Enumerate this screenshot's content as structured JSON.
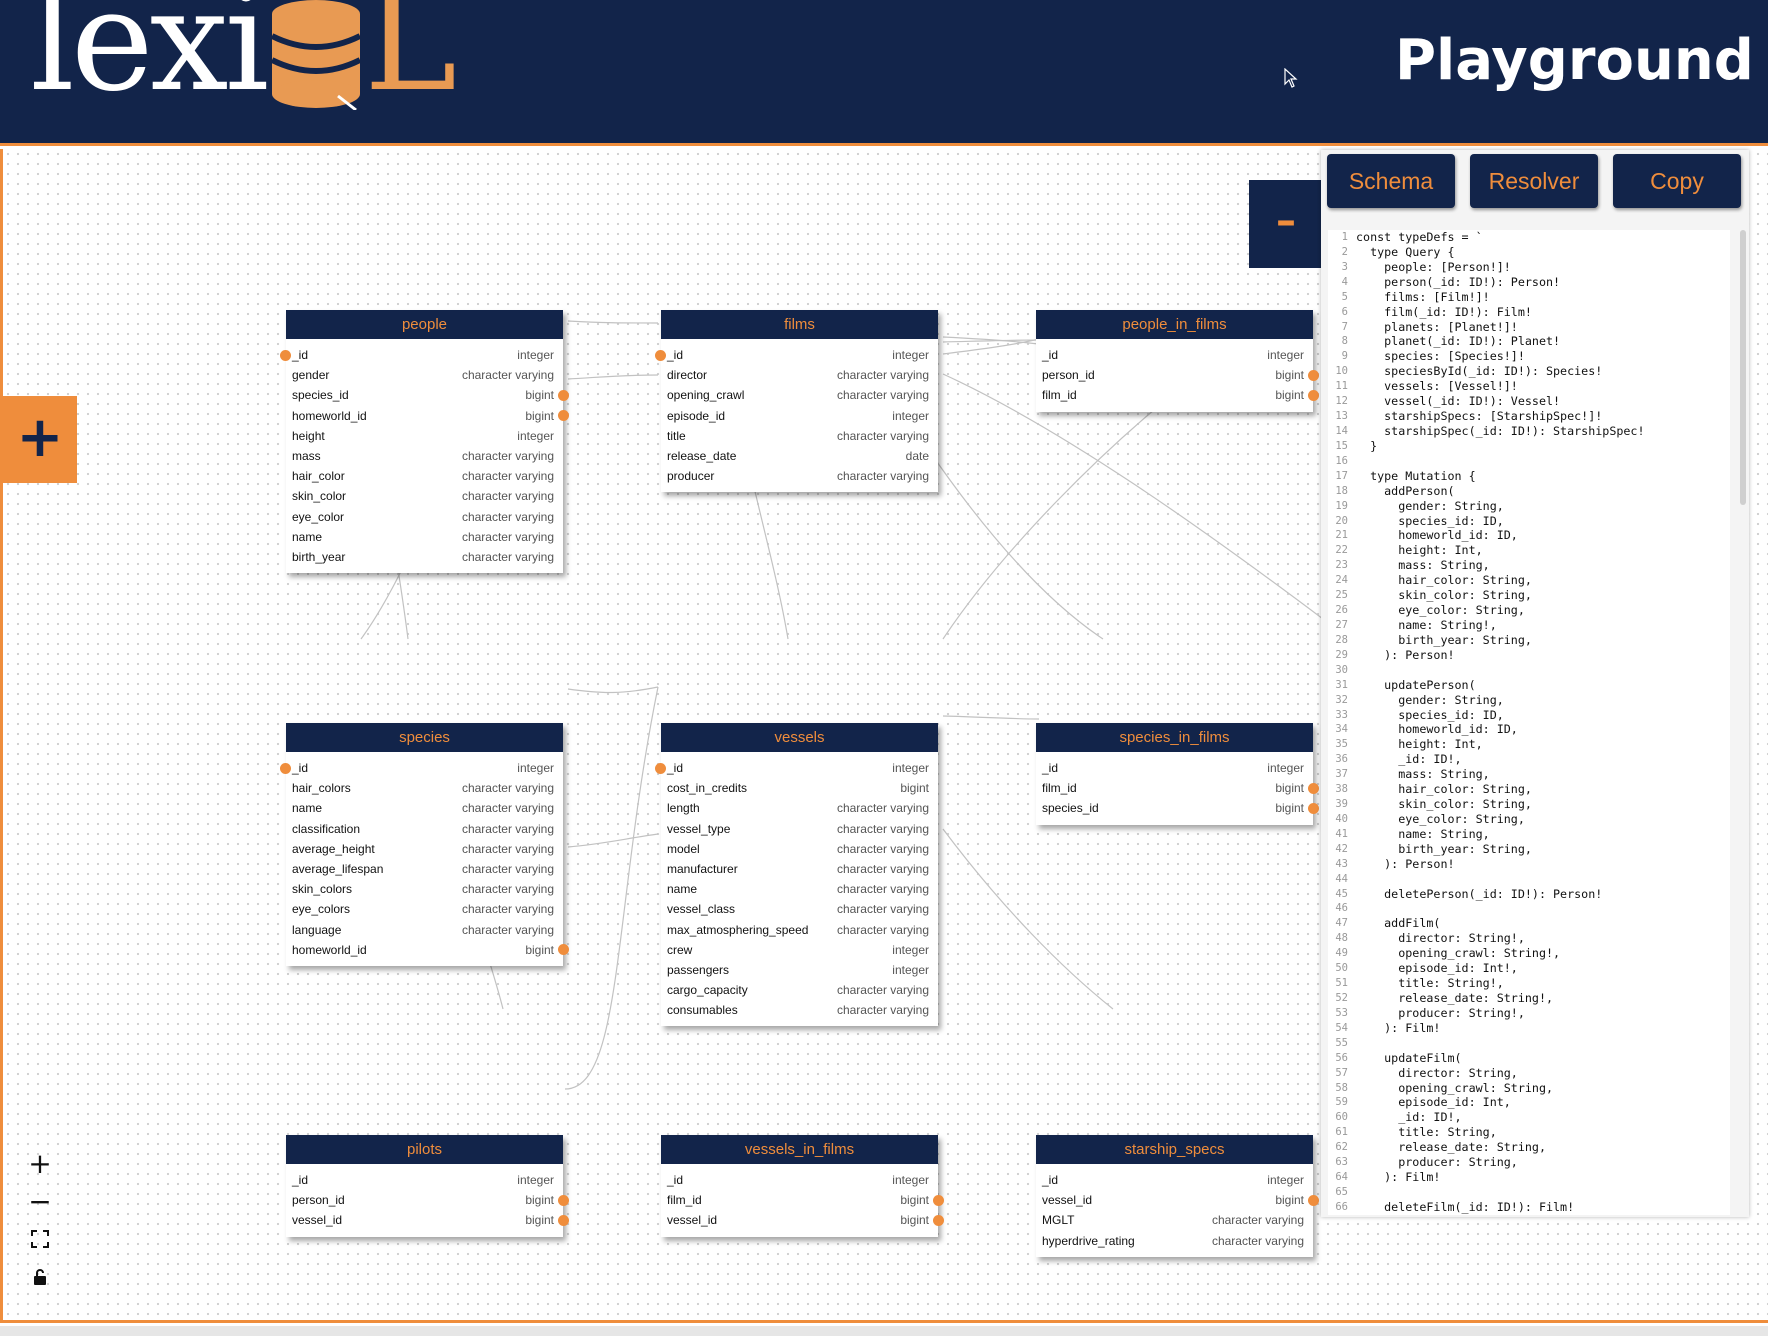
{
  "header": {
    "logo_text": "lexi",
    "logo_letter": "L",
    "title": "Playground"
  },
  "controls": {
    "add_panel_label": "+",
    "collapse_label": "–",
    "zoom_in": "+",
    "zoom_out": "−",
    "fit_view": "⛶",
    "lock": "🔒"
  },
  "panel": {
    "tabs": [
      "Schema",
      "Resolver",
      "Copy"
    ],
    "code_lines": [
      "const typeDefs = `",
      "  type Query {",
      "    people: [Person!]!",
      "    person(_id: ID!): Person!",
      "    films: [Film!]!",
      "    film(_id: ID!): Film!",
      "    planets: [Planet!]!",
      "    planet(_id: ID!): Planet!",
      "    species: [Species!]!",
      "    speciesById(_id: ID!): Species!",
      "    vessels: [Vessel!]!",
      "    vessel(_id: ID!): Vessel!",
      "    starshipSpecs: [StarshipSpec!]!",
      "    starshipSpec(_id: ID!): StarshipSpec!",
      "  }",
      "",
      "  type Mutation {",
      "    addPerson(",
      "      gender: String,",
      "      species_id: ID,",
      "      homeworld_id: ID,",
      "      height: Int,",
      "      mass: String,",
      "      hair_color: String,",
      "      skin_color: String,",
      "      eye_color: String,",
      "      name: String!,",
      "      birth_year: String,",
      "    ): Person!",
      "",
      "    updatePerson(",
      "      gender: String,",
      "      species_id: ID,",
      "      homeworld_id: ID,",
      "      height: Int,",
      "      _id: ID!,",
      "      mass: String,",
      "      hair_color: String,",
      "      skin_color: String,",
      "      eye_color: String,",
      "      name: String,",
      "      birth_year: String,",
      "    ): Person!",
      "",
      "    deletePerson(_id: ID!): Person!",
      "",
      "    addFilm(",
      "      director: String!,",
      "      opening_crawl: String!,",
      "      episode_id: Int!,",
      "      title: String!,",
      "      release_date: String!,",
      "      producer: String!,",
      "    ): Film!",
      "",
      "    updateFilm(",
      "      director: String,",
      "      opening_crawl: String,",
      "      episode_id: Int,",
      "      _id: ID!,",
      "      title: String,",
      "      release_date: String,",
      "      producer: String,",
      "    ): Film!",
      "",
      "    deleteFilm(_id: ID!): Film!"
    ]
  },
  "tables": [
    {
      "name": "people",
      "columns": [
        {
          "name": "_id",
          "type": "integer",
          "left": true
        },
        {
          "name": "gender",
          "type": "character varying"
        },
        {
          "name": "species_id",
          "type": "bigint",
          "right": true
        },
        {
          "name": "homeworld_id",
          "type": "bigint",
          "right": true
        },
        {
          "name": "height",
          "type": "integer"
        },
        {
          "name": "mass",
          "type": "character varying"
        },
        {
          "name": "hair_color",
          "type": "character varying"
        },
        {
          "name": "skin_color",
          "type": "character varying"
        },
        {
          "name": "eye_color",
          "type": "character varying"
        },
        {
          "name": "name",
          "type": "character varying"
        },
        {
          "name": "birth_year",
          "type": "character varying"
        }
      ]
    },
    {
      "name": "films",
      "columns": [
        {
          "name": "_id",
          "type": "integer",
          "left": true
        },
        {
          "name": "director",
          "type": "character varying"
        },
        {
          "name": "opening_crawl",
          "type": "character varying"
        },
        {
          "name": "episode_id",
          "type": "integer"
        },
        {
          "name": "title",
          "type": "character varying"
        },
        {
          "name": "release_date",
          "type": "date"
        },
        {
          "name": "producer",
          "type": "character varying"
        }
      ]
    },
    {
      "name": "people_in_films",
      "columns": [
        {
          "name": "_id",
          "type": "integer"
        },
        {
          "name": "person_id",
          "type": "bigint",
          "right": true
        },
        {
          "name": "film_id",
          "type": "bigint",
          "right": true
        }
      ]
    },
    {
      "name": "species",
      "columns": [
        {
          "name": "_id",
          "type": "integer",
          "left": true
        },
        {
          "name": "hair_colors",
          "type": "character varying"
        },
        {
          "name": "name",
          "type": "character varying"
        },
        {
          "name": "classification",
          "type": "character varying"
        },
        {
          "name": "average_height",
          "type": "character varying"
        },
        {
          "name": "average_lifespan",
          "type": "character varying"
        },
        {
          "name": "skin_colors",
          "type": "character varying"
        },
        {
          "name": "eye_colors",
          "type": "character varying"
        },
        {
          "name": "language",
          "type": "character varying"
        },
        {
          "name": "homeworld_id",
          "type": "bigint",
          "right": true
        }
      ]
    },
    {
      "name": "vessels",
      "columns": [
        {
          "name": "_id",
          "type": "integer",
          "left": true
        },
        {
          "name": "cost_in_credits",
          "type": "bigint"
        },
        {
          "name": "length",
          "type": "character varying"
        },
        {
          "name": "vessel_type",
          "type": "character varying"
        },
        {
          "name": "model",
          "type": "character varying"
        },
        {
          "name": "manufacturer",
          "type": "character varying"
        },
        {
          "name": "name",
          "type": "character varying"
        },
        {
          "name": "vessel_class",
          "type": "character varying"
        },
        {
          "name": "max_atmosphering_speed",
          "type": "character varying"
        },
        {
          "name": "crew",
          "type": "integer"
        },
        {
          "name": "passengers",
          "type": "integer"
        },
        {
          "name": "cargo_capacity",
          "type": "character varying"
        },
        {
          "name": "consumables",
          "type": "character varying"
        }
      ]
    },
    {
      "name": "species_in_films",
      "columns": [
        {
          "name": "_id",
          "type": "integer"
        },
        {
          "name": "film_id",
          "type": "bigint",
          "right": true
        },
        {
          "name": "species_id",
          "type": "bigint",
          "right": true
        }
      ]
    },
    {
      "name": "pilots",
      "columns": [
        {
          "name": "_id",
          "type": "integer"
        },
        {
          "name": "person_id",
          "type": "bigint",
          "right": true
        },
        {
          "name": "vessel_id",
          "type": "bigint",
          "right": true
        }
      ]
    },
    {
      "name": "vessels_in_films",
      "columns": [
        {
          "name": "_id",
          "type": "integer"
        },
        {
          "name": "film_id",
          "type": "bigint",
          "right": true
        },
        {
          "name": "vessel_id",
          "type": "bigint",
          "right": true
        }
      ]
    },
    {
      "name": "starship_specs",
      "columns": [
        {
          "name": "_id",
          "type": "integer"
        },
        {
          "name": "vessel_id",
          "type": "bigint",
          "right": true
        },
        {
          "name": "MGLT",
          "type": "character varying"
        },
        {
          "name": "hyperdrive_rating",
          "type": "character varying"
        }
      ]
    }
  ],
  "colors": {
    "navy": "#12244a",
    "orange": "#ef8d3c"
  }
}
